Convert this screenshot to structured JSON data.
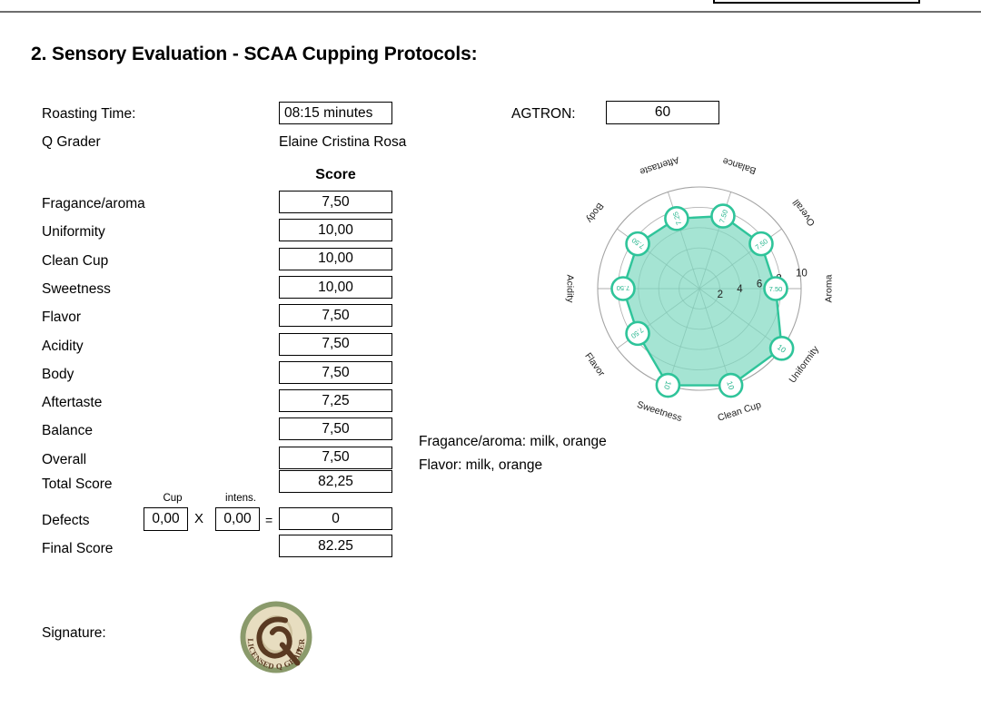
{
  "section": {
    "title": "2. Sensory Evaluation - SCAA Cupping Protocols:"
  },
  "header_fields": {
    "roasting_time_label": "Roasting Time:",
    "roasting_time_value": "08:15 minutes",
    "q_grader_label": "Q Grader",
    "q_grader_value": "Elaine Cristina Rosa",
    "agtron_label": "AGTRON:",
    "agtron_value": "60"
  },
  "score_table": {
    "header": "Score",
    "rows": [
      {
        "label": "Fragance/aroma",
        "value": "7,50"
      },
      {
        "label": "Uniformity",
        "value": "10,00"
      },
      {
        "label": "Clean Cup",
        "value": "10,00"
      },
      {
        "label": "Sweetness",
        "value": "10,00"
      },
      {
        "label": "Flavor",
        "value": "7,50"
      },
      {
        "label": "Acidity",
        "value": "7,50"
      },
      {
        "label": "Body",
        "value": "7,50"
      },
      {
        "label": "Aftertaste",
        "value": "7,25"
      },
      {
        "label": "Balance",
        "value": "7,50"
      },
      {
        "label": "Overall",
        "value": "7,50"
      }
    ],
    "total_label": "Total Score",
    "total_value": "82,25",
    "defects_label": "Defects",
    "defects_cup_caption": "Cup",
    "defects_cup_value": "0,00",
    "defects_operator": "X",
    "defects_intens_caption": "intens.",
    "defects_intens_value": "0,00",
    "defects_equals": "=",
    "defects_result": "0",
    "final_label": "Final Score",
    "final_value": "82.25"
  },
  "notes": [
    "Fragance/aroma: milk, orange",
    "Flavor: milk, orange"
  ],
  "signature": {
    "label": "Signature:",
    "seal_text": "LICENSED Q GRADER",
    "seal_letter": "Q"
  },
  "colors": {
    "accent": "#2fc49a",
    "fill": "#7fd9c0",
    "grid": "#9a9a9a",
    "marker_text": "#22b48c",
    "seal_ring": "#8a9a6b",
    "seal_face": "#e7ddc0",
    "seal_letter": "#5a3a22"
  },
  "chart_data": {
    "type": "radar",
    "title": "",
    "categories": [
      "Aroma",
      "Overall",
      "Balance",
      "Aftertaste",
      "Body",
      "Acidity",
      "Flavor",
      "Sweetness",
      "Clean Cup",
      "Uniformity"
    ],
    "values": [
      7.5,
      7.5,
      7.5,
      7.25,
      7.5,
      7.5,
      7.5,
      10,
      10,
      10
    ],
    "point_labels": [
      "7.50",
      "7.50",
      "7.50",
      "7.25",
      "7.50",
      "7.50",
      "7.50",
      "10",
      "10",
      "10"
    ],
    "radial_ticks": [
      2,
      4,
      6,
      8,
      10
    ],
    "radial_tick_labels": [
      "2",
      "4",
      "6",
      "8",
      "10"
    ],
    "rlim": [
      0,
      10
    ],
    "grid": true,
    "legend": "none",
    "start_angle_deg": 0,
    "direction": "counterclockwise"
  }
}
